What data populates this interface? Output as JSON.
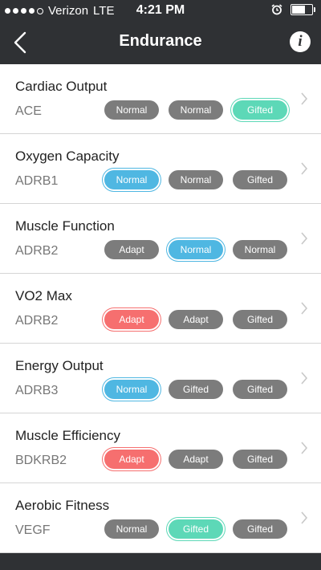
{
  "status": {
    "carrier": "Verizon",
    "network": "LTE",
    "time": "4:21 PM"
  },
  "header": {
    "title": "Endurance",
    "info_label": "i"
  },
  "rows": [
    {
      "title": "Cardiac Output",
      "gene": "ACE",
      "pills": [
        "Normal",
        "Normal",
        "Gifted"
      ],
      "selected": 2,
      "selected_color": "green"
    },
    {
      "title": "Oxygen Capacity",
      "gene": "ADRB1",
      "pills": [
        "Normal",
        "Normal",
        "Gifted"
      ],
      "selected": 0,
      "selected_color": "blue"
    },
    {
      "title": "Muscle Function",
      "gene": "ADRB2",
      "pills": [
        "Adapt",
        "Normal",
        "Normal"
      ],
      "selected": 1,
      "selected_color": "blue"
    },
    {
      "title": "VO2 Max",
      "gene": "ADRB2",
      "pills": [
        "Adapt",
        "Adapt",
        "Gifted"
      ],
      "selected": 0,
      "selected_color": "red"
    },
    {
      "title": "Energy Output",
      "gene": "ADRB3",
      "pills": [
        "Normal",
        "Gifted",
        "Gifted"
      ],
      "selected": 0,
      "selected_color": "blue"
    },
    {
      "title": "Muscle Efficiency",
      "gene": "BDKRB2",
      "pills": [
        "Adapt",
        "Adapt",
        "Gifted"
      ],
      "selected": 0,
      "selected_color": "red"
    },
    {
      "title": "Aerobic Fitness",
      "gene": "VEGF",
      "pills": [
        "Normal",
        "Gifted",
        "Gifted"
      ],
      "selected": 1,
      "selected_color": "green"
    }
  ],
  "colors": {
    "bar": "#2f3134",
    "pill_default": "#7c7c7c",
    "blue": "#4fb7e2",
    "red": "#f66f6f",
    "green": "#5dd8b7"
  }
}
